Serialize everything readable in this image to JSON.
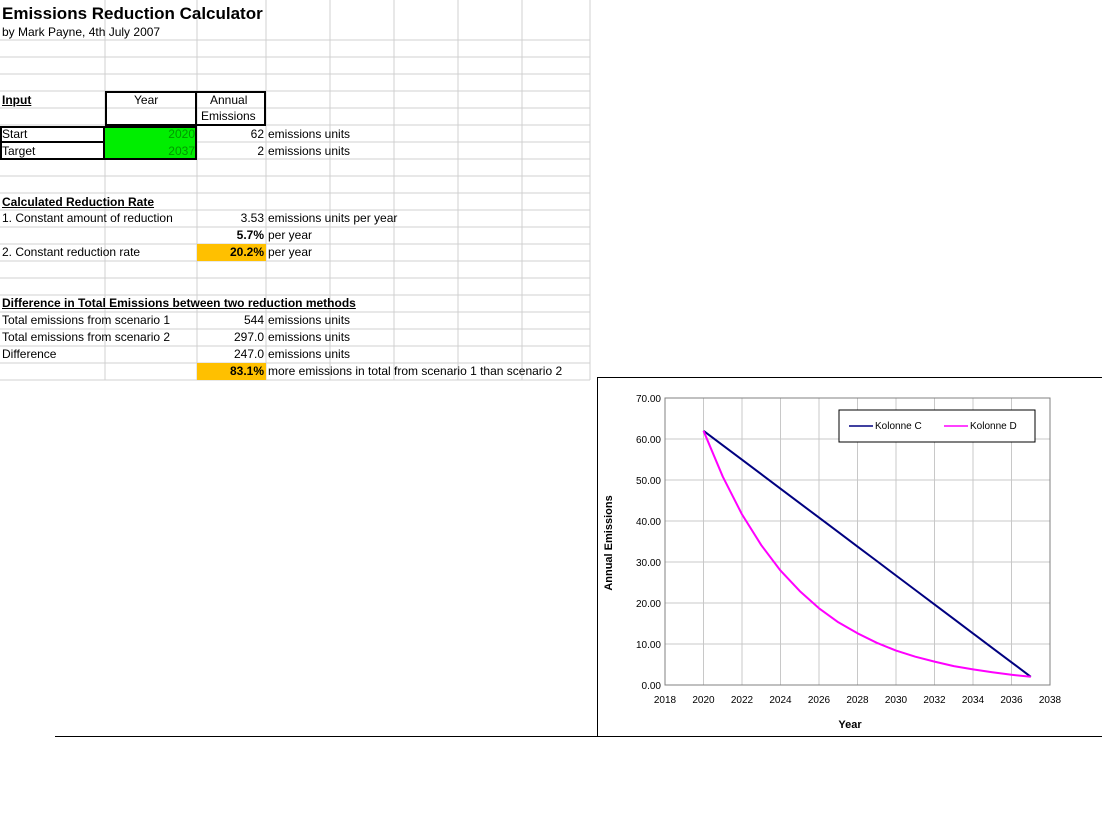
{
  "sheet": {
    "title": "Emissions Reduction Calculator",
    "byline": "by Mark Payne, 4th July 2007"
  },
  "input": {
    "heading": "Input",
    "col_year": "Year",
    "col_annual_1": "Annual",
    "col_annual_2": "Emissions",
    "start_label": "Start",
    "start_year": "2020",
    "start_emissions": "62",
    "target_label": "Target",
    "target_year": "2037",
    "target_emissions": "2",
    "units": "emissions units"
  },
  "rate": {
    "heading": "Calculated Reduction Rate",
    "method1_label": "1. Constant amount of reduction",
    "method1_value": "3.53",
    "method1_unit": "emissions units per year",
    "method1_pct": "5.7%",
    "method1_pct_unit": "per year",
    "method2_label": "2. Constant reduction rate",
    "method2_pct": "20.2%",
    "method2_pct_unit": "per year"
  },
  "difference": {
    "heading": "Difference in Total Emissions between two reduction methods",
    "total1_label": "Total emissions from scenario 1",
    "total1_value": "544",
    "total2_label": "Total emissions from scenario 2",
    "total2_value": "297.0",
    "diff_label": "Difference",
    "diff_value": "247.0",
    "units": "emissions units",
    "pct_value": "83.1%",
    "pct_text": "more emissions in total from scenario 1 than scenario 2"
  },
  "chart_data": {
    "type": "line",
    "title": "",
    "xlabel": "Year",
    "ylabel": "Annual Emissions",
    "xlim": [
      2018,
      2038
    ],
    "ylim": [
      0,
      70
    ],
    "x_ticks": [
      "2018",
      "2020",
      "2022",
      "2024",
      "2026",
      "2028",
      "2030",
      "2032",
      "2034",
      "2036",
      "2038"
    ],
    "y_ticks": [
      "0.00",
      "10.00",
      "20.00",
      "30.00",
      "40.00",
      "50.00",
      "60.00",
      "70.00"
    ],
    "grid": true,
    "legend_position": "top-right",
    "series": [
      {
        "name": "Kolonne C",
        "color": "#000080",
        "x": [
          2020,
          2021,
          2022,
          2023,
          2024,
          2025,
          2026,
          2027,
          2028,
          2029,
          2030,
          2031,
          2032,
          2033,
          2034,
          2035,
          2036,
          2037
        ],
        "values": [
          62.0,
          58.47,
          54.94,
          51.41,
          47.88,
          44.35,
          40.82,
          37.29,
          33.76,
          30.24,
          26.71,
          23.18,
          19.65,
          16.12,
          12.59,
          9.06,
          5.53,
          2.0
        ]
      },
      {
        "name": "Kolonne D",
        "color": "#ff00ff",
        "x": [
          2020,
          2021,
          2022,
          2023,
          2024,
          2025,
          2026,
          2027,
          2028,
          2029,
          2030,
          2031,
          2032,
          2033,
          2034,
          2035,
          2036,
          2037
        ],
        "values": [
          62.0,
          50.8,
          41.6,
          34.1,
          27.9,
          22.9,
          18.7,
          15.3,
          12.6,
          10.3,
          8.4,
          6.9,
          5.7,
          4.6,
          3.8,
          3.1,
          2.5,
          2.0
        ]
      }
    ]
  }
}
